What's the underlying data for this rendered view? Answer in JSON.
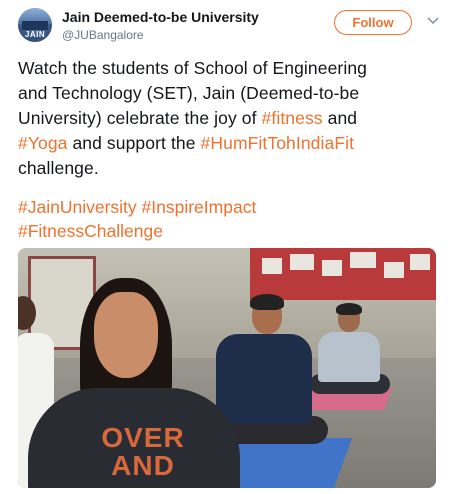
{
  "account": {
    "display_name": "Jain Deemed-to-be University",
    "handle": "@JUBangalore",
    "avatar_text": "JAIN"
  },
  "actions": {
    "follow_label": "Follow",
    "more_icon": "chevron-down-icon"
  },
  "tweet": {
    "line1": "Watch the students of School of Engineering",
    "line2": "and Technology (SET), Jain (Deemed-to-be",
    "line3_pre": "University) celebrate the joy of ",
    "line3_tag": "#fitness",
    "line3_post": " and",
    "line4_tag1": "#Yoga",
    "line4_mid": " and support the ",
    "line4_tag2": "#HumFitTohIndiaFit",
    "line5": "challenge.",
    "hashtags": [
      "#JainUniversity",
      "#InspireImpact",
      "#FitnessChallenge"
    ]
  },
  "media": {
    "shirt_text_line1": "OVER",
    "shirt_text_line2": "AND"
  },
  "colors": {
    "accent": "#f0722e",
    "text": "#14171a",
    "muted": "#657786"
  }
}
